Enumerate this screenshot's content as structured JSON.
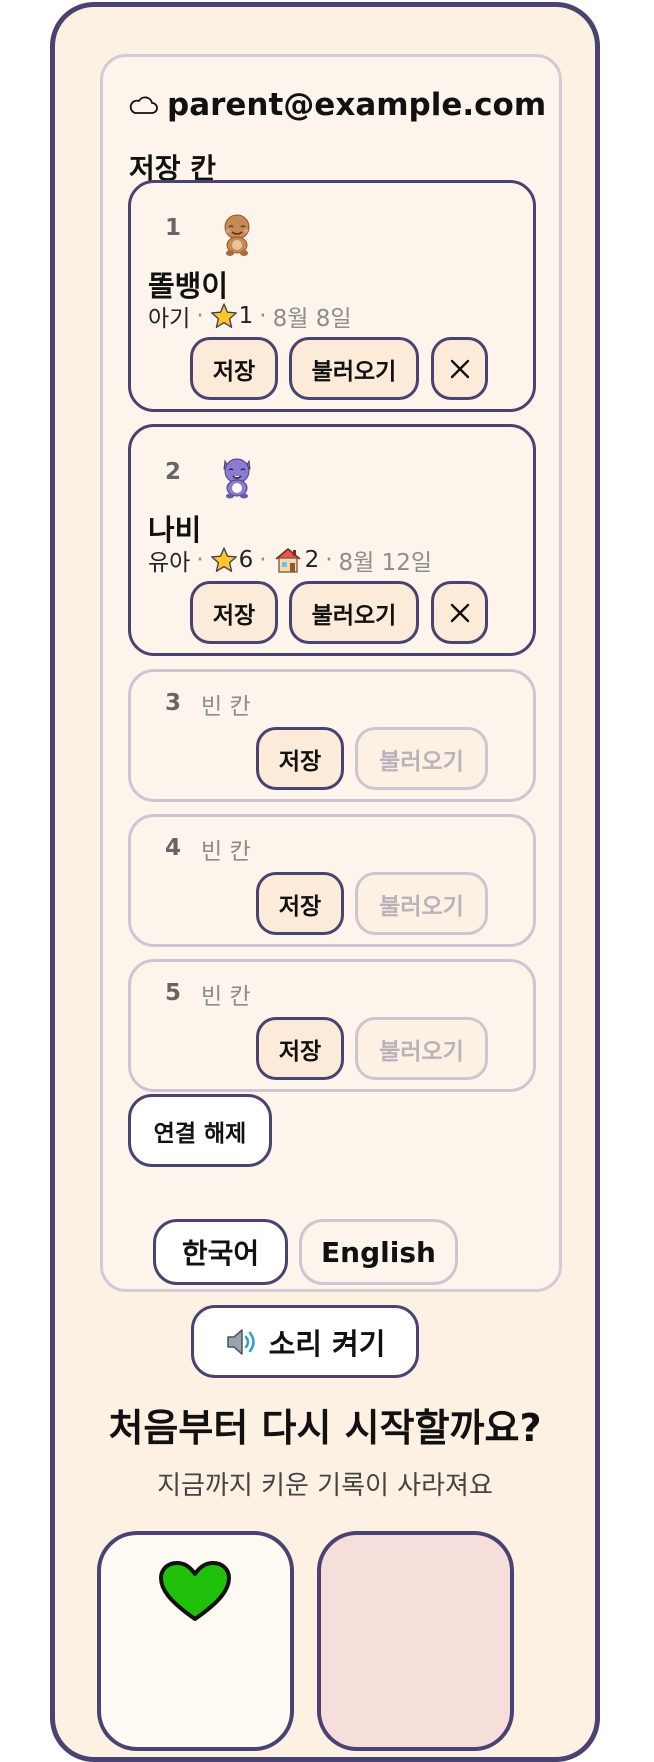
{
  "account": {
    "icon": "cloud-icon",
    "email": "parent@example.com"
  },
  "saves": {
    "title": "저장 칸",
    "slots": [
      {
        "num": "1",
        "pet_icon": "brown-bear-icon",
        "name": "똘뱅이",
        "stage": "아기",
        "stars": "1",
        "date": "8월 8일",
        "save_label": "저장",
        "load_label": "불러오기",
        "delete_label": "×"
      },
      {
        "num": "2",
        "pet_icon": "purple-cat-icon",
        "name": "나비",
        "stage": "유아",
        "stars": "6",
        "houses": "2",
        "date": "8월 12일",
        "save_label": "저장",
        "load_label": "불러오기",
        "delete_label": "×"
      },
      {
        "num": "3",
        "empty_label": "빈 칸",
        "save_label": "저장",
        "load_label": "불러오기"
      },
      {
        "num": "4",
        "empty_label": "빈 칸",
        "save_label": "저장",
        "load_label": "불러오기"
      },
      {
        "num": "5",
        "empty_label": "빈 칸",
        "save_label": "저장",
        "load_label": "불러오기"
      }
    ],
    "disconnect_label": "연결 해제"
  },
  "language": {
    "korean": "한국어",
    "english": "English",
    "selected": "한국어"
  },
  "sound": {
    "icon": "speaker-icon",
    "label": "소리 켜기"
  },
  "reset": {
    "title": "처음부터 다시 시작할까요?",
    "subtitle": "지금까지 키운 기록이 사라져요",
    "keep_icon": "green-heart-icon"
  },
  "colors": {
    "border": "#4a4270",
    "background": "#fcf1e3",
    "button": "#fcebd9",
    "reset_button": "#f6dedb",
    "heart": "#1fc10b"
  }
}
